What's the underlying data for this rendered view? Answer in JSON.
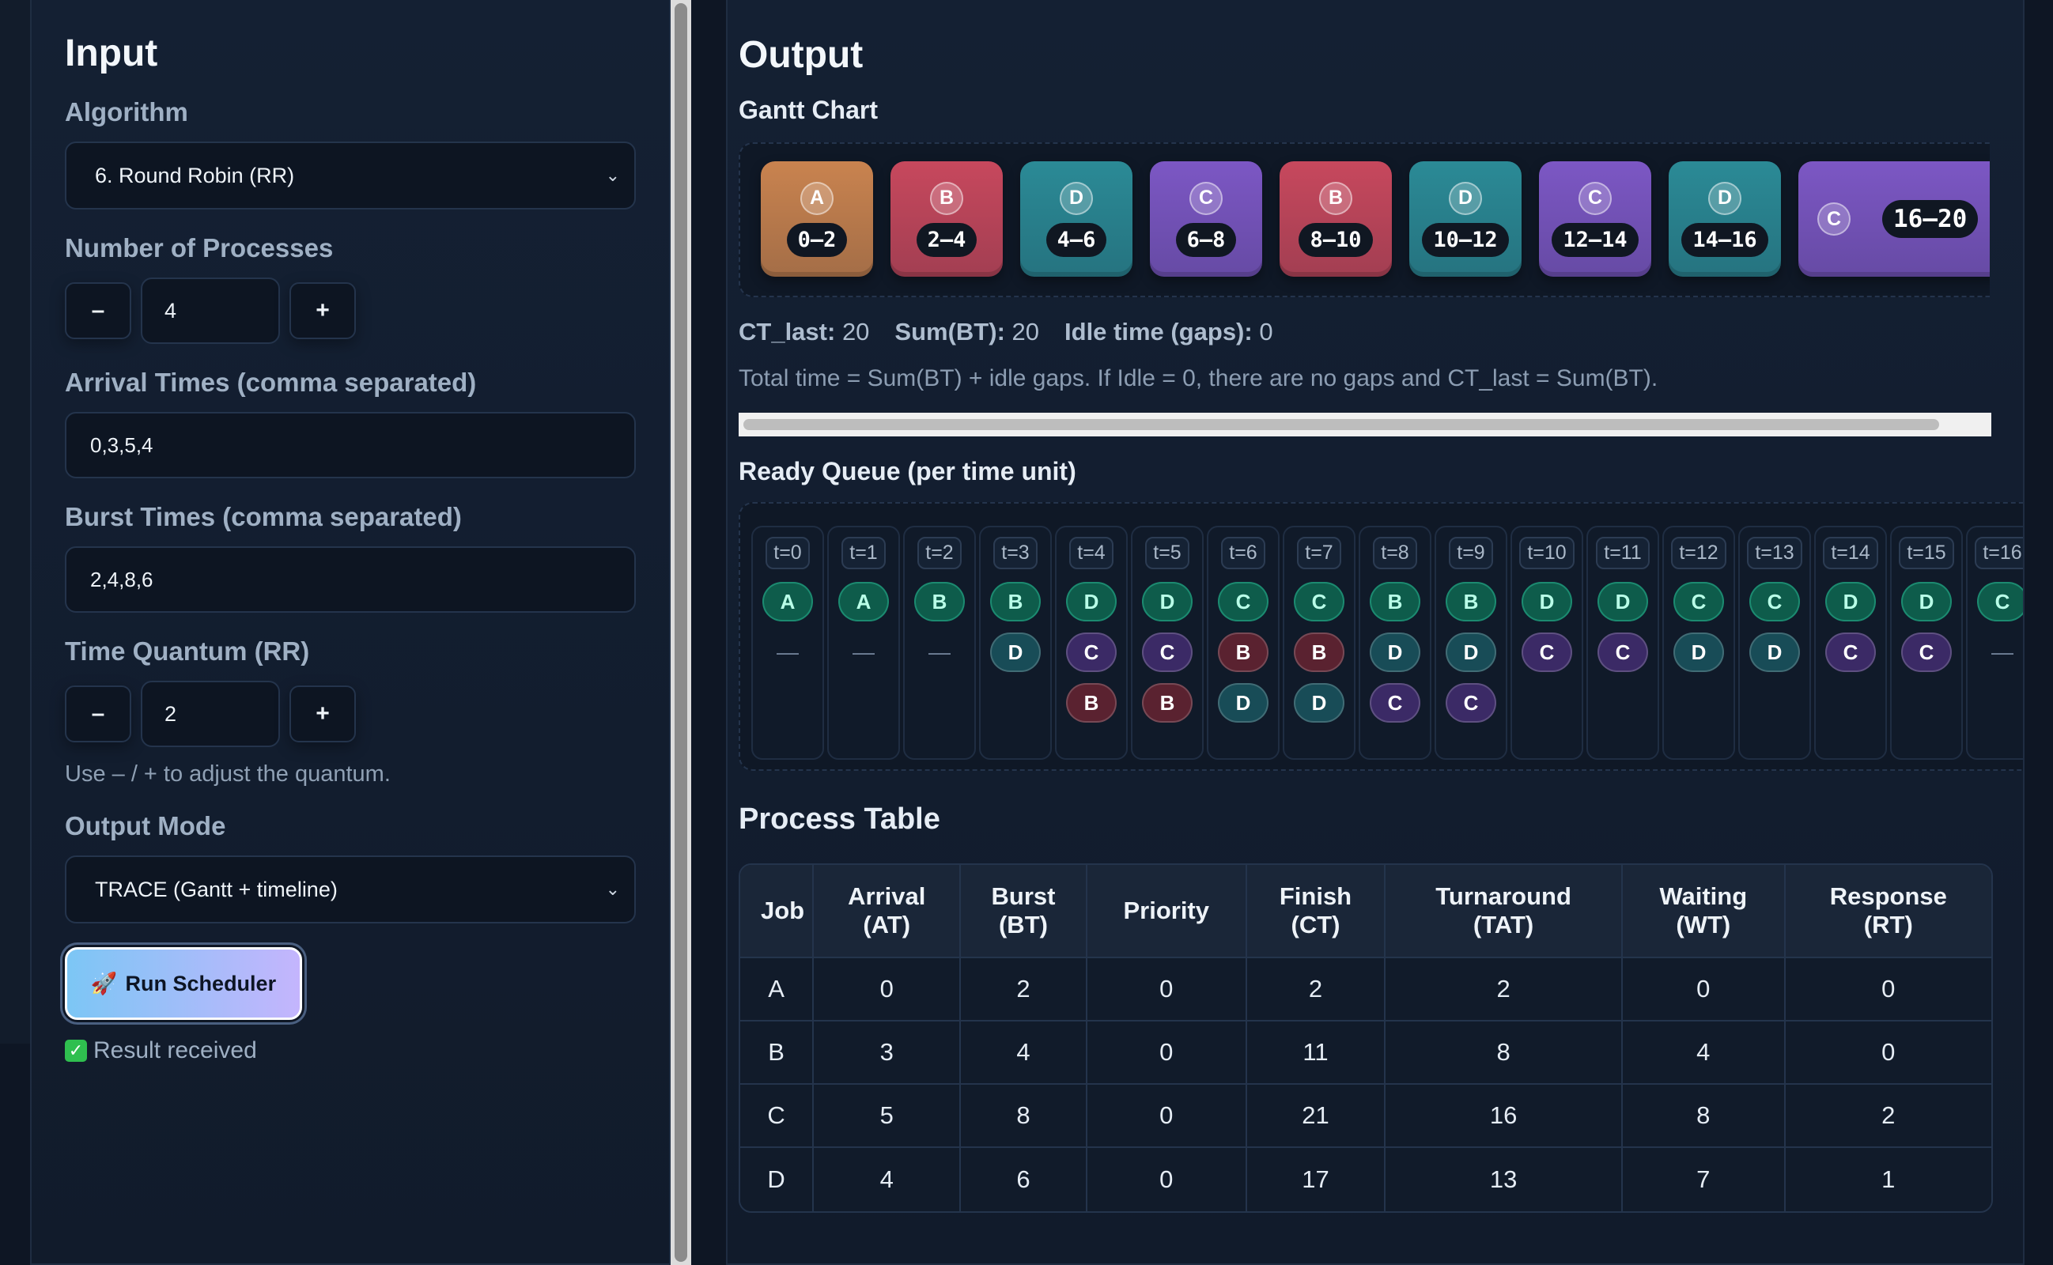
{
  "input": {
    "title": "Input",
    "algorithm_label": "Algorithm",
    "algorithm_value": "6. Round Robin (RR)",
    "num_processes_label": "Number of Processes",
    "num_processes_value": "4",
    "minus": "–",
    "plus": "+",
    "arrival_label": "Arrival Times (comma separated)",
    "arrival_value": "0,3,5,4",
    "burst_label": "Burst Times (comma separated)",
    "burst_value": "2,4,8,6",
    "quantum_label": "Time Quantum (RR)",
    "quantum_value": "2",
    "quantum_hint": "Use – / + to adjust the quantum.",
    "output_mode_label": "Output Mode",
    "output_mode_value": "TRACE (Gantt + timeline)",
    "run_button": "Run Scheduler",
    "run_icon": "🚀",
    "status_text": "Result received",
    "status_icon": "✓"
  },
  "output": {
    "title": "Output",
    "gantt_title": "Gantt Chart",
    "gantt": [
      {
        "job": "A",
        "range": "0–2",
        "color": "#c9834f"
      },
      {
        "job": "B",
        "range": "2–4",
        "color": "#c7485d"
      },
      {
        "job": "D",
        "range": "4–6",
        "color": "#2b8a96"
      },
      {
        "job": "C",
        "range": "6–8",
        "color": "#7c57c4"
      },
      {
        "job": "B",
        "range": "8–10",
        "color": "#c7485d"
      },
      {
        "job": "D",
        "range": "10–12",
        "color": "#2b8a96"
      },
      {
        "job": "C",
        "range": "12–14",
        "color": "#7c57c4"
      },
      {
        "job": "D",
        "range": "14–16",
        "color": "#2b8a96"
      },
      {
        "job": "C",
        "range": "16–20",
        "color": "#7c57c4"
      }
    ],
    "stats": {
      "ct_last_label": "CT_last:",
      "ct_last": "20",
      "sum_bt_label": "Sum(BT):",
      "sum_bt": "20",
      "idle_label": "Idle time (gaps):",
      "idle": "0"
    },
    "note": "Total time = Sum(BT) + idle gaps. If Idle = 0, there are no gaps and CT_last = Sum(BT).",
    "ready_queue_title": "Ready Queue (per time unit)",
    "ready_queue": [
      {
        "t": "t=0",
        "q": [
          "A"
        ]
      },
      {
        "t": "t=1",
        "q": [
          "A"
        ]
      },
      {
        "t": "t=2",
        "q": [
          "B"
        ]
      },
      {
        "t": "t=3",
        "q": [
          "B",
          "D"
        ]
      },
      {
        "t": "t=4",
        "q": [
          "D",
          "C",
          "B"
        ]
      },
      {
        "t": "t=5",
        "q": [
          "D",
          "C",
          "B"
        ]
      },
      {
        "t": "t=6",
        "q": [
          "C",
          "B",
          "D"
        ]
      },
      {
        "t": "t=7",
        "q": [
          "C",
          "B",
          "D"
        ]
      },
      {
        "t": "t=8",
        "q": [
          "B",
          "D",
          "C"
        ]
      },
      {
        "t": "t=9",
        "q": [
          "B",
          "D",
          "C"
        ]
      },
      {
        "t": "t=10",
        "q": [
          "D",
          "C"
        ]
      },
      {
        "t": "t=11",
        "q": [
          "D",
          "C"
        ]
      },
      {
        "t": "t=12",
        "q": [
          "C",
          "D"
        ]
      },
      {
        "t": "t=13",
        "q": [
          "C",
          "D"
        ]
      },
      {
        "t": "t=14",
        "q": [
          "D",
          "C"
        ]
      },
      {
        "t": "t=15",
        "q": [
          "D",
          "C"
        ]
      },
      {
        "t": "t=16",
        "q": [
          "C"
        ]
      }
    ],
    "empty_marker": "—",
    "chip_colors": {
      "A": {
        "bg": "#0f5a4a",
        "fg": "#7ff0d0"
      },
      "B": {
        "bg": "#0f5a4a",
        "fg": "#7ff0d0"
      },
      "C": {
        "bg": "#0f5a4a",
        "fg": "#7ff0d0"
      },
      "D": {
        "bg": "#0f5a4a",
        "fg": "#7ff0d0"
      }
    },
    "table_title": "Process Table",
    "table_headers": [
      "Job",
      "Arrival\n(AT)",
      "Burst\n(BT)",
      "Priority",
      "Finish\n(CT)",
      "Turnaround\n(TAT)",
      "Waiting\n(WT)",
      "Response\n(RT)"
    ],
    "table_rows": [
      [
        "A",
        "0",
        "2",
        "0",
        "2",
        "2",
        "0",
        "0"
      ],
      [
        "B",
        "3",
        "4",
        "0",
        "11",
        "8",
        "4",
        "0"
      ],
      [
        "C",
        "5",
        "8",
        "0",
        "21",
        "16",
        "8",
        "2"
      ],
      [
        "D",
        "4",
        "6",
        "0",
        "17",
        "13",
        "7",
        "1"
      ]
    ]
  }
}
